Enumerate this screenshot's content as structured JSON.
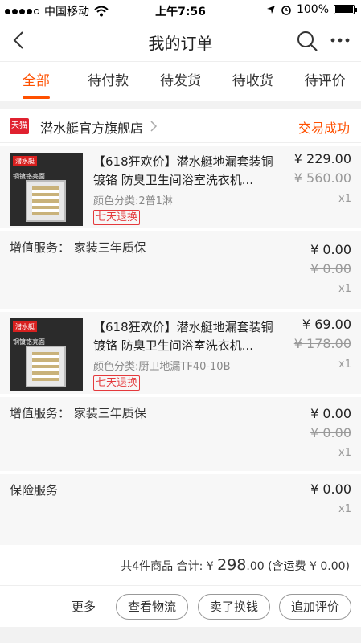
{
  "status_bar": {
    "carrier": "中国移动",
    "time": "上午7:56",
    "battery": "100%",
    "battery_level": 1.0
  },
  "nav": {
    "title": "我的订单"
  },
  "tabs": [
    {
      "label": "全部",
      "active": true
    },
    {
      "label": "待付款",
      "active": false
    },
    {
      "label": "待发货",
      "active": false
    },
    {
      "label": "待收货",
      "active": false
    },
    {
      "label": "待评价",
      "active": false
    }
  ],
  "order": {
    "shop_badge": "天猫",
    "shop_name": "潜水艇官方旗舰店",
    "status": "交易成功",
    "items": [
      {
        "title": "【618狂欢价】潜水艇地漏套装铜镀铬 防臭卫生间浴室洗衣机...",
        "sku": "颜色分类:2普1淋",
        "return_policy": "七天退换",
        "price": "¥ 229.00",
        "original_price": "¥ 560.00",
        "quantity": "x1",
        "thumb_brand": "潜水艇",
        "thumb_caption": "铜镀铬亮面"
      },
      {
        "title": "【618狂欢价】潜水艇地漏套装铜镀铬 防臭卫生间浴室洗衣机...",
        "sku": "颜色分类:厨卫地漏TF40-10B",
        "return_policy": "七天退换",
        "price": "¥ 69.00",
        "original_price": "¥ 178.00",
        "quantity": "x1",
        "thumb_brand": "潜水艇",
        "thumb_caption": "铜镀铬亮面"
      }
    ],
    "services": [
      {
        "label": "增值服务： 家装三年质保",
        "price": "¥ 0.00",
        "original_price": "¥ 0.00",
        "quantity": "x1"
      },
      {
        "label": "增值服务： 家装三年质保",
        "price": "¥ 0.00",
        "original_price": "¥ 0.00",
        "quantity": "x1"
      },
      {
        "label": "保险服务",
        "price": "¥ 0.00",
        "quantity": "x1"
      }
    ],
    "summary": {
      "count_text": "共4件商品 合计: ¥ ",
      "total": "298",
      "total_decimals": ".00",
      "shipping_text": " (含运费 ¥ 0.00)"
    },
    "actions": {
      "more": "更多",
      "track": "查看物流",
      "resell": "卖了换钱",
      "review": "追加评价"
    }
  },
  "colors": {
    "accent": "#ff5000",
    "tmall_red": "#e0212f"
  }
}
